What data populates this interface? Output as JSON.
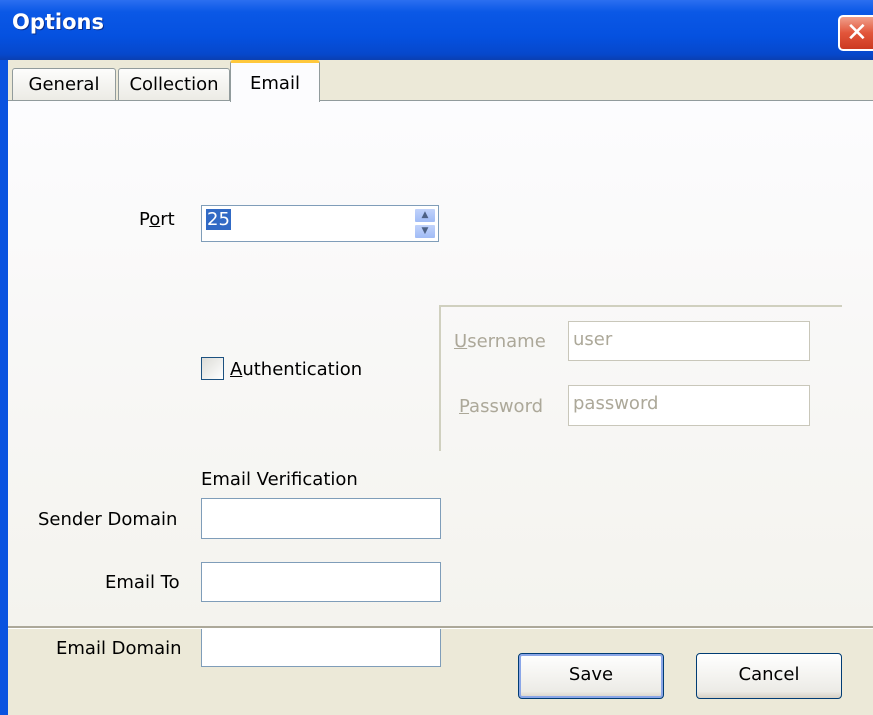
{
  "window": {
    "title": "Options",
    "close_glyph": "✕"
  },
  "tabs": [
    {
      "label": "General"
    },
    {
      "label": "Collection"
    },
    {
      "label": "Email",
      "active": true
    }
  ],
  "email_tab": {
    "port": {
      "label_pre": "P",
      "label_mnemonic": "o",
      "label_post": "rt",
      "value": "25"
    },
    "authentication": {
      "label_mnemonic": "A",
      "label_post": "uthentication",
      "checked": false
    },
    "username": {
      "label_mnemonic": "U",
      "label_post": "sername",
      "value": "user"
    },
    "password": {
      "label_mnemonic": "P",
      "label_post": "assword",
      "value": "password"
    },
    "email_verification_heading": "Email Verification",
    "sender_domain": {
      "label": "Sender Domain",
      "value": ""
    },
    "email_to": {
      "label": "Email To",
      "value": ""
    },
    "email_domain": {
      "label": "Email Domain",
      "value": ""
    }
  },
  "buttons": {
    "save": "Save",
    "cancel": "Cancel"
  },
  "icons": {
    "spin_up": "▲",
    "spin_down": "▼"
  },
  "colors": {
    "title_bar": "#0551e0",
    "dialog_bg": "#ece9d8",
    "active_tab_accent": "#ffc83c",
    "close_button": "#e2553a",
    "selection": "#316ac5"
  }
}
